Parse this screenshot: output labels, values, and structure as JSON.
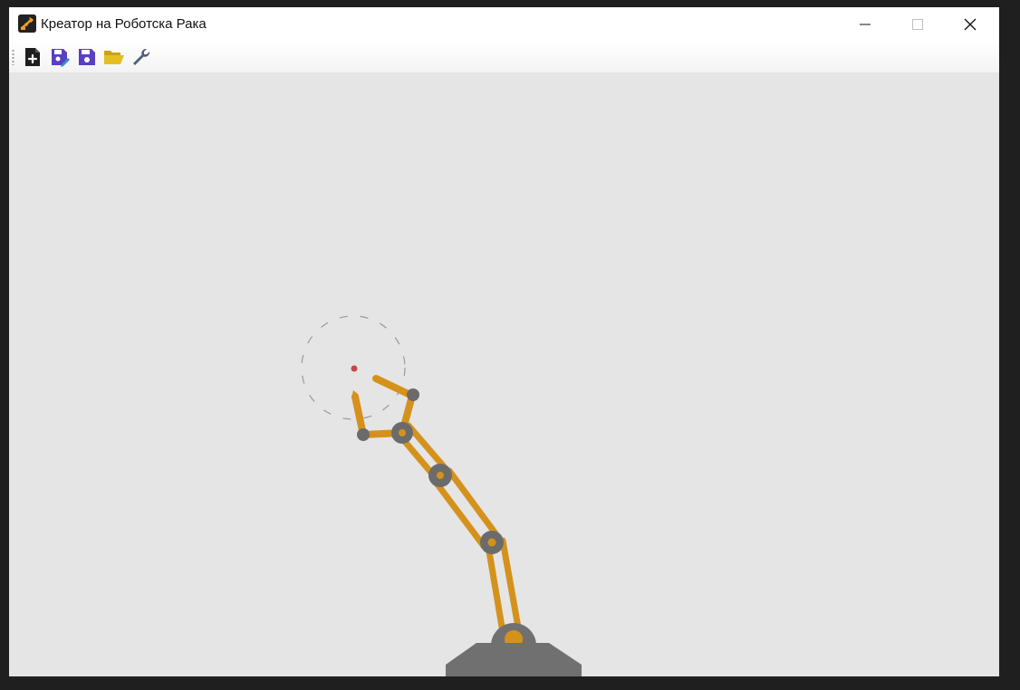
{
  "window": {
    "title": "Креатор на Роботска Рака",
    "app_icon": "robot-arm-app-icon",
    "controls": [
      "minimize-icon",
      "maximize-icon",
      "close-icon"
    ]
  },
  "toolbar": {
    "buttons": [
      {
        "name": "new-file",
        "icon": "new-document-icon",
        "color": "#1e1e1e"
      },
      {
        "name": "edit-save",
        "icon": "save-edit-icon",
        "color": "#5a3fc0"
      },
      {
        "name": "save",
        "icon": "floppy-disk-icon",
        "color": "#5a3fc0"
      },
      {
        "name": "open-folder",
        "icon": "folder-open-icon",
        "color": "#d4b012"
      },
      {
        "name": "settings",
        "icon": "wrench-icon",
        "color": "#4e5f7e"
      }
    ]
  },
  "canvas": {
    "background": "#e5e5e5",
    "arm_color": "#d4921c",
    "joint_color": "#6b6b6b",
    "base_color": "#707070",
    "target_color": "#cc4444",
    "reach_circle_color": "#9a9a9a"
  }
}
